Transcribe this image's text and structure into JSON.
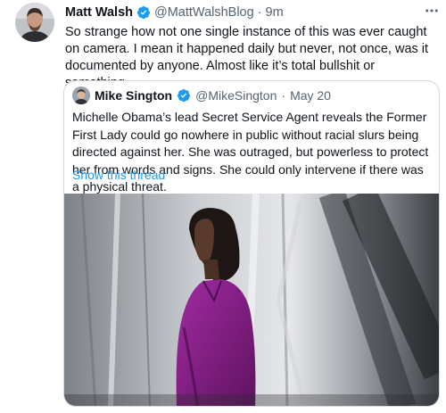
{
  "tweet": {
    "author_name": "Matt Walsh",
    "handle": "@MattWalshBlog",
    "separator": "·",
    "time": "9m",
    "more_icon": "more-horizontal-icon",
    "body": "So strange how not one single instance of this was ever caught on camera. I mean it happened daily but never, not once, was it documented by anyone. Almost like it’s total bullshit or something."
  },
  "quote": {
    "author_name": "Mike Sington",
    "handle": "@MikeSington",
    "separator": "·",
    "date": "May 20",
    "body": "Michelle Obama’s lead Secret Service Agent reveals the Former First Lady could go nowhere in public without racial slurs being directed against her. She was outraged, but powerless to protect her from words and signs. She could only intervene if there was a physical threat.",
    "show_thread": "Show this thread"
  },
  "colors": {
    "verified": "#1d9bf0",
    "link": "#1d9bf0",
    "muted": "#536471",
    "border": "#cfd9de",
    "jacket": "#8a1f8a"
  }
}
